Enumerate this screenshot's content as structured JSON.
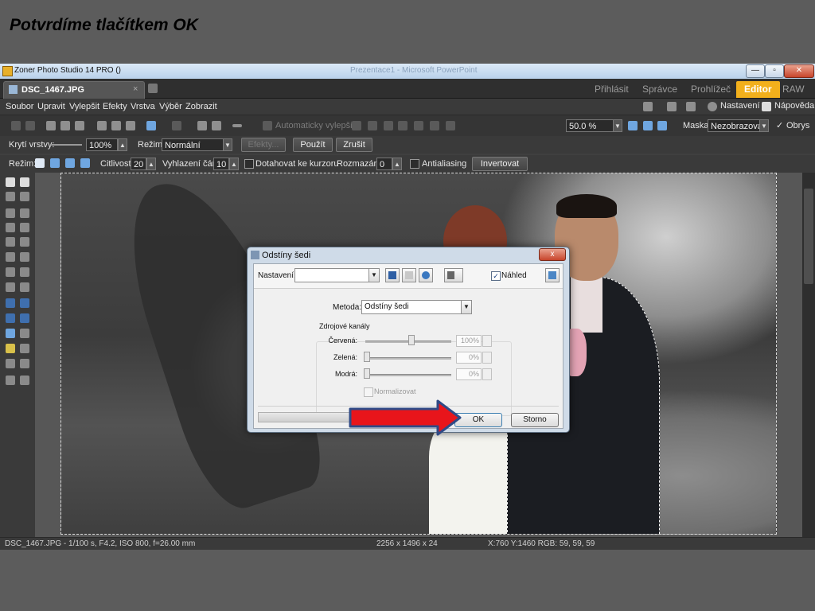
{
  "slide": {
    "title": "Potvrdíme tlačítkem OK"
  },
  "window": {
    "title": "Zoner Photo Studio 14 PRO  ()",
    "ghost_title": "Prezentace1 - Microsoft PowerPoint",
    "controls": {
      "minimize": "—",
      "maximize": "▫",
      "close": "✕"
    }
  },
  "tabs": {
    "document": "DSC_1467.JPG",
    "close_glyph": "×",
    "modes": [
      "Přihlásit",
      "Správce",
      "Prohlížeč",
      "Editor",
      "RAW"
    ],
    "active_mode": "Editor"
  },
  "menu": {
    "items": [
      "Soubor",
      "Upravit",
      "Vylepšit",
      "Efekty",
      "Vrstva",
      "Výběr",
      "Zobrazit"
    ],
    "right": {
      "settings": "Nastavení",
      "help": "Nápověda"
    }
  },
  "toolbar": {
    "auto_enhance": "Automaticky vylepšit",
    "zoom": "50.0 %",
    "mask_label": "Maska:",
    "mask_value": "Nezobrazovat",
    "outline_label": "Obrys",
    "outline_checked": true
  },
  "layer_options": {
    "opacity_label": "Krytí vrstvy:",
    "opacity_value": "100%",
    "mode_label": "Režim:",
    "mode_value": "Normální",
    "effects_btn": "Efekty...",
    "apply_btn": "Použít",
    "cancel_btn": "Zrušit"
  },
  "selection_options": {
    "mode_label": "Režim:",
    "sensitivity_label": "Citlivost:",
    "sensitivity_value": "20",
    "smoothing_label": "Vyhlazení čáry:",
    "smoothing_value": "10",
    "snap_label": "Dotahovat ke kurzoru",
    "blur_label": "Rozmazání:",
    "blur_value": "0",
    "antialias_label": "Antialiasing",
    "invert_btn": "Invertovat"
  },
  "status": {
    "file_info": "DSC_1467.JPG - 1/100 s, F4.2, ISO 800, f=26.00 mm",
    "dimensions": "2256 x 1496 x 24",
    "cursor": "X:760 Y:1460   RGB: 59, 59, 59"
  },
  "dialog": {
    "title": "Odstíny šedi",
    "close_glyph": "x",
    "preset_label": "Nastavení:",
    "preset_value": "",
    "preview_label": "Náhled",
    "preview_checked": true,
    "method_label": "Metoda:",
    "method_value": "Odstíny šedi",
    "group_label": "Zdrojové kanály",
    "channels": [
      {
        "label": "Červená:",
        "value": "100%",
        "level": 1.0
      },
      {
        "label": "Zelená:",
        "value": "0%",
        "level": 0.0
      },
      {
        "label": "Modrá:",
        "value": "0%",
        "level": 0.0
      }
    ],
    "normalize_label": "Normalizovat",
    "normalize_checked": false,
    "ok_label": "OK",
    "cancel_label": "Storno"
  },
  "colors": {
    "accent_active_tab": "#f2b01c",
    "arrow_red": "#e8151b",
    "arrow_outline": "#2f4a86"
  }
}
